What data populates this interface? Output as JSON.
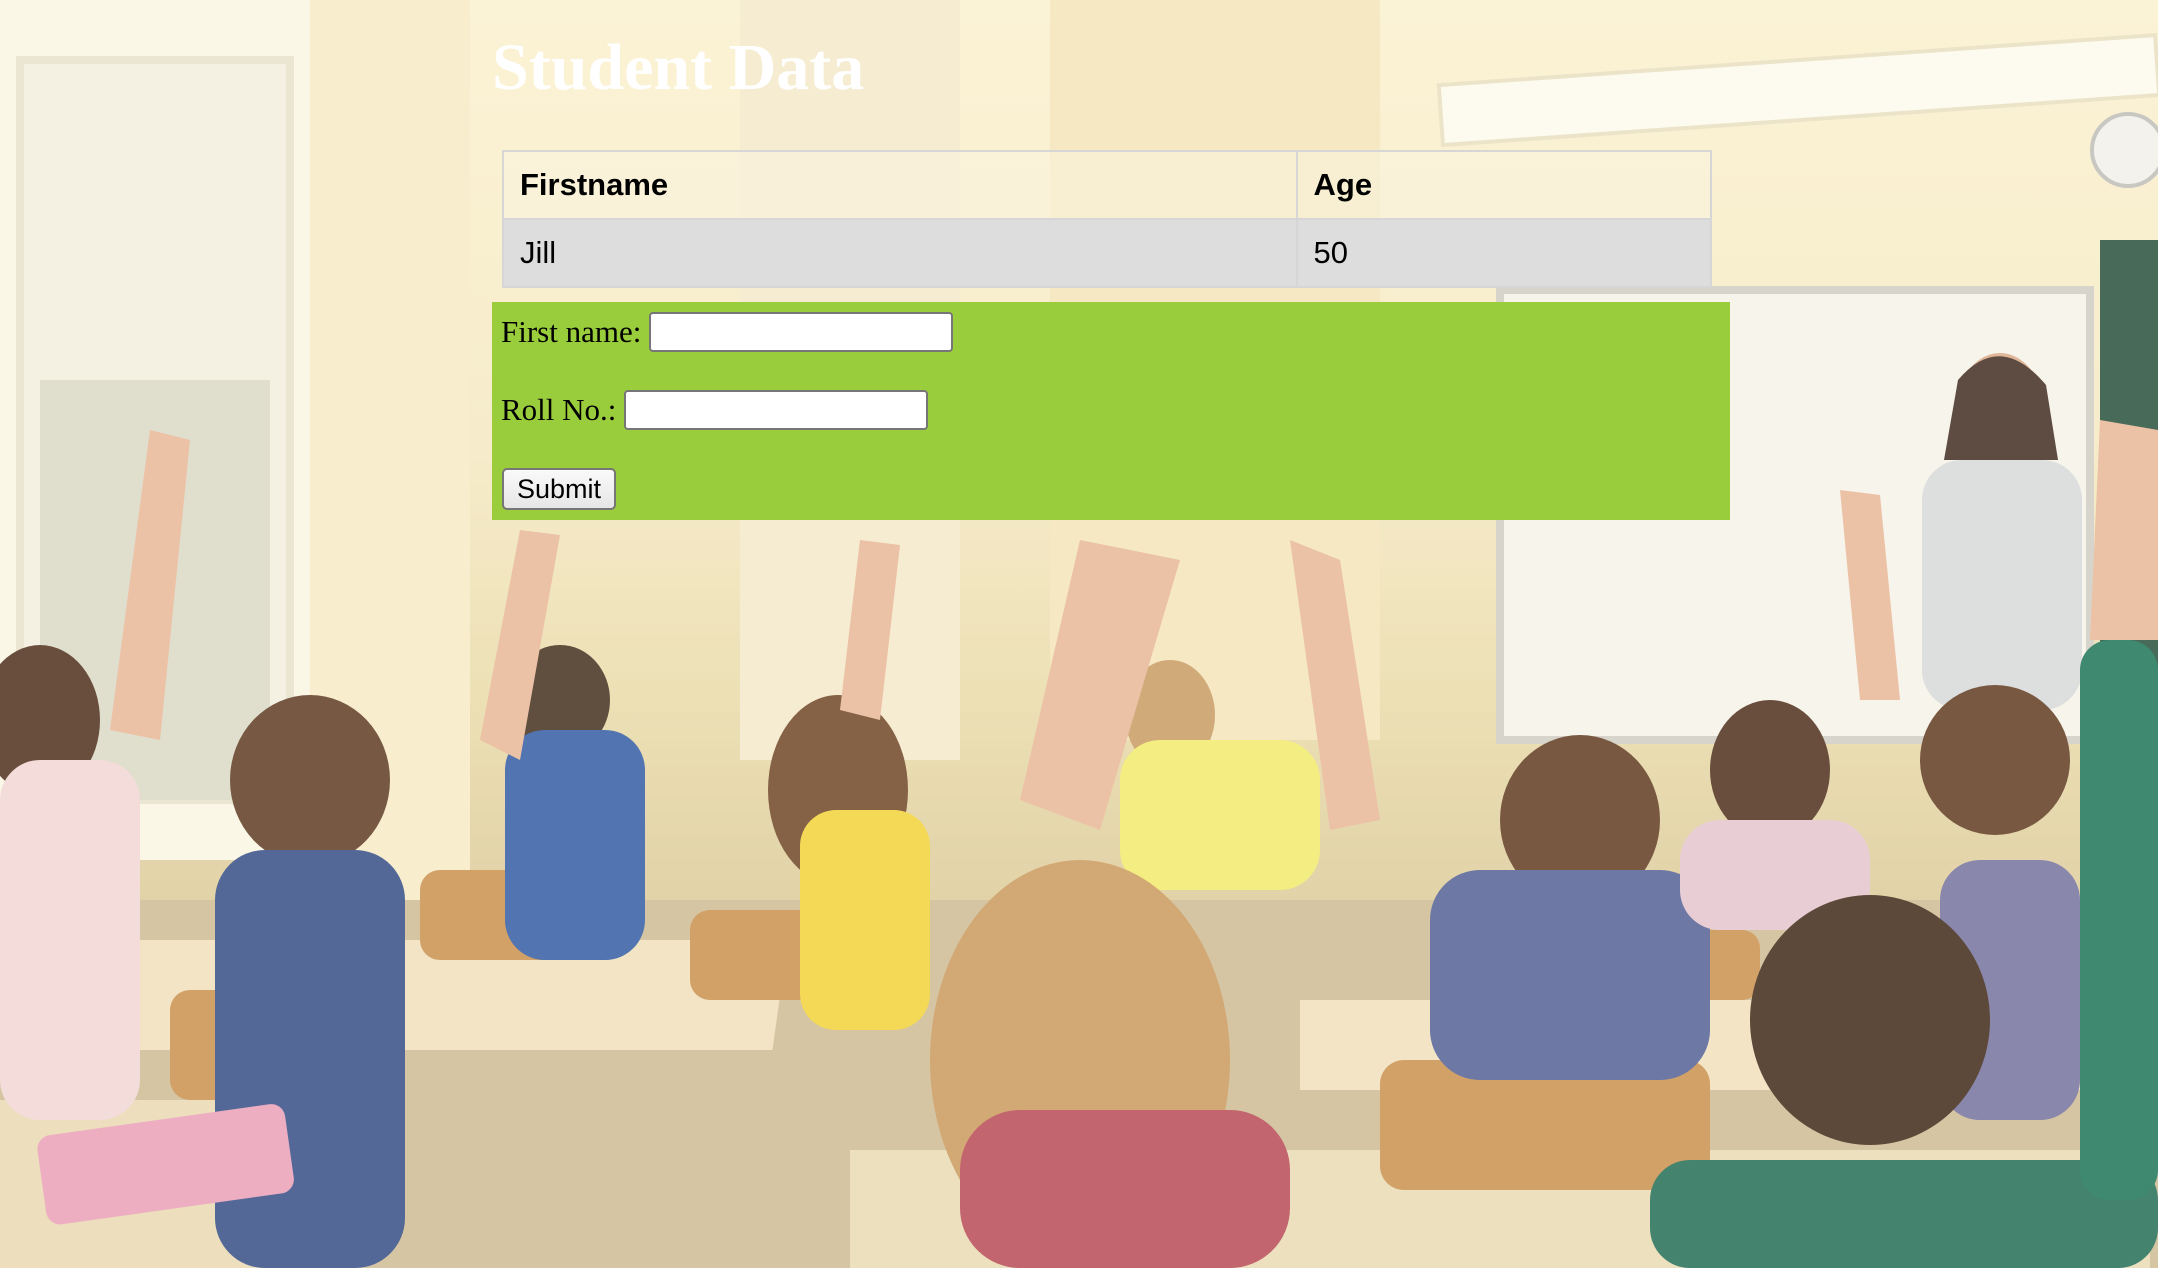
{
  "page": {
    "title": "Student Data"
  },
  "table": {
    "headers": [
      "Firstname",
      "Age"
    ],
    "rows": [
      [
        "Jill",
        "50"
      ]
    ]
  },
  "form": {
    "first_name_label": "First name:",
    "first_name_value": "",
    "roll_no_label": "Roll No.:",
    "roll_no_value": "",
    "submit_label": "Submit",
    "background_color": "#9acd32"
  },
  "theme": {
    "title_color": "#ffffff",
    "cell_background": "#dddddd"
  }
}
